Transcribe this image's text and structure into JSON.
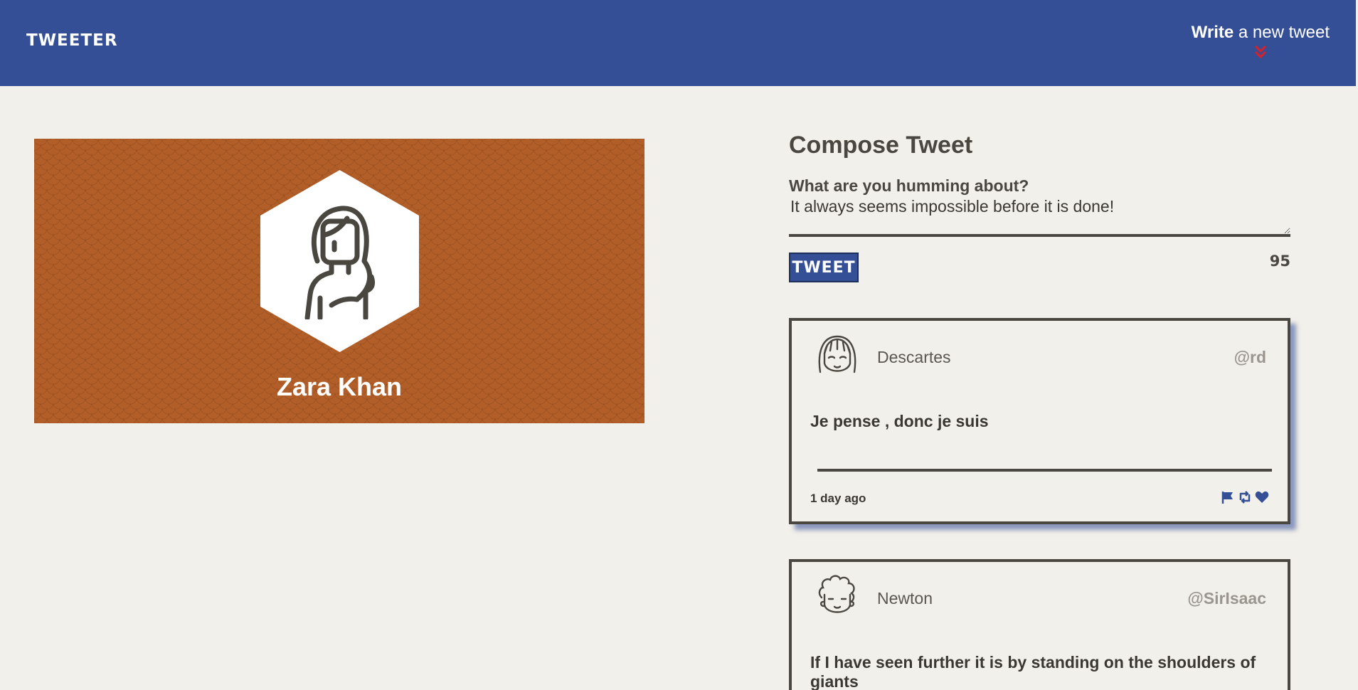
{
  "nav": {
    "logo": "TWEETER",
    "compose_bold": "Write",
    "compose_rest": " a new tweet",
    "arrow_icon": "double-chevron-down-icon",
    "arrow_color": "#d6212a"
  },
  "profile": {
    "name": "Zara Khan",
    "avatar_icon": "woman-avatar-icon",
    "background_color": "#b15e28"
  },
  "compose": {
    "title": "Compose Tweet",
    "label": "What are you humming about?",
    "value": "It always seems impossible before it is done!",
    "button_label": "TWEET",
    "counter": "95"
  },
  "tweets": [
    {
      "avatar_icon": "girl-avatar-icon",
      "name": "Descartes",
      "handle": "@rd",
      "content": "Je pense , donc je suis",
      "time": "1 day ago",
      "actions": [
        "flag-icon",
        "retweet-icon",
        "heart-icon"
      ]
    },
    {
      "avatar_icon": "curly-hair-man-avatar-icon",
      "name": "Newton",
      "handle": "@SirIsaac",
      "content": "If I have seen further it is by standing on the shoulders of giants"
    }
  ],
  "colors": {
    "nav_blue": "#344f95",
    "page_bg": "#f2f0ea",
    "text_dark": "#4a4640"
  }
}
